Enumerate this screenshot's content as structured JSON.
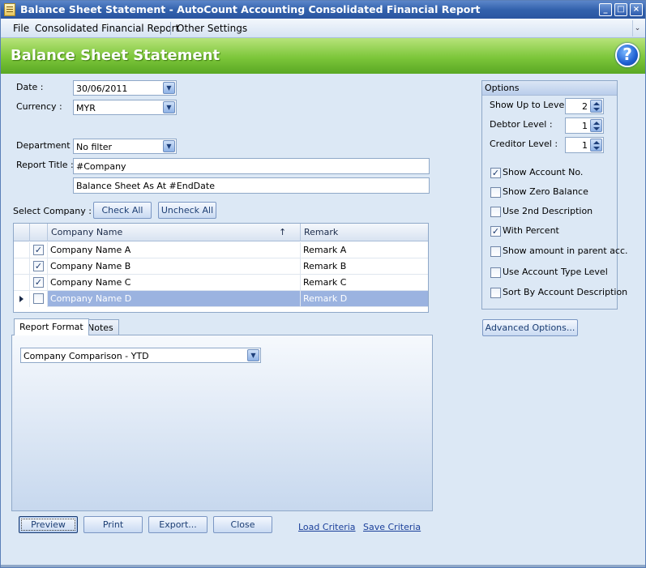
{
  "window": {
    "title": "Balance Sheet Statement - AutoCount Accounting Consolidated Financial Report",
    "minimize": "_",
    "maximize": "□",
    "close": "×"
  },
  "menu": {
    "file": "File",
    "consolidated": "Consolidated Financial Report",
    "other": "Other Settings",
    "overflow": "⌄"
  },
  "header": {
    "title": "Balance Sheet Statement",
    "help": "?"
  },
  "form": {
    "date_label": "Date :",
    "date_value": "30/06/2011",
    "currency_label": "Currency :",
    "currency_value": "MYR",
    "department_label": "Department :",
    "department_value": "No filter",
    "report_title_label": "Report Title :",
    "report_title_1": "#Company",
    "report_title_2": "Balance Sheet As At #EndDate",
    "select_company_label": "Select Company :",
    "check_all": "Check All",
    "uncheck_all": "Uncheck All"
  },
  "grid": {
    "col_company": "Company Name",
    "col_remark": "Remark",
    "sort_icon": "↑",
    "rows": [
      {
        "name": "Company Name A",
        "remark": "Remark A",
        "checked": "✓"
      },
      {
        "name": "Company Name B",
        "remark": "Remark B",
        "checked": "✓"
      },
      {
        "name": "Company Name C",
        "remark": "Remark C",
        "checked": "✓"
      },
      {
        "name": "Company Name D",
        "remark": "Remark D",
        "checked": ""
      }
    ]
  },
  "tabs": {
    "report_format": "Report Format",
    "notes": "Notes",
    "format_value": "Company Comparison - YTD"
  },
  "options": {
    "title": "Options",
    "show_up_to_level_label": "Show Up to Level",
    "show_up_to_level": "2",
    "debtor_level_label": "Debtor Level :",
    "debtor_level": "1",
    "creditor_level_label": "Creditor Level :",
    "creditor_level": "1",
    "checks": [
      {
        "label": "Show Account No.",
        "checked": "✓"
      },
      {
        "label": "Show Zero Balance",
        "checked": ""
      },
      {
        "label": "Use 2nd Description",
        "checked": ""
      },
      {
        "label": "With Percent",
        "checked": "✓"
      },
      {
        "label": "Show amount in parent acc.",
        "checked": ""
      },
      {
        "label": "Use Account Type Level",
        "checked": ""
      },
      {
        "label": "Sort By Account Description",
        "checked": ""
      }
    ],
    "advanced": "Advanced Options..."
  },
  "footer": {
    "preview": "Preview",
    "print": "Print",
    "export": "Export...",
    "close": "Close",
    "load_criteria": "Load Criteria",
    "save_criteria": "Save Criteria"
  }
}
